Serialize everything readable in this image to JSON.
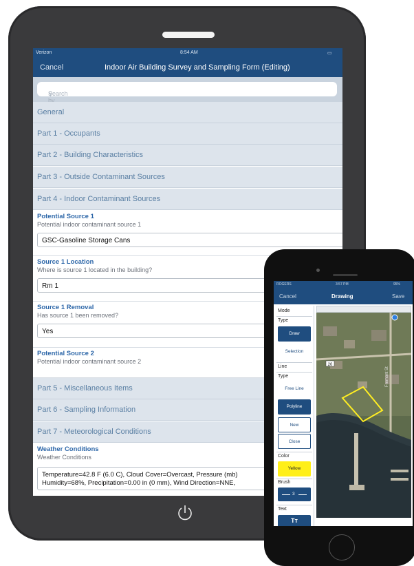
{
  "tablet": {
    "status": {
      "carrier": "Verizon",
      "time": "8:54 AM"
    },
    "nav": {
      "cancel": "Cancel",
      "title": "Indoor Air Building Survey and Sampling Form (Editing)"
    },
    "search": {
      "placeholder": "Search by name"
    },
    "sections": [
      "General",
      "Part 1 - Occupants",
      "Part 2 - Building Characteristics",
      "Part 3 - Outside Contaminant Sources",
      "Part 4 - Indoor Contaminant Sources",
      "Part 5 - Miscellaneous Items",
      "Part 6 - Sampling Information",
      "Part 7 - Meteorological Conditions"
    ],
    "fields": [
      {
        "label": "Potential Source 1",
        "sub": "Potential indoor contaminant source 1",
        "value": "GSC-Gasoline Storage Cans"
      },
      {
        "label": "Source 1 Location",
        "sub": "Where is source 1 located in the building?",
        "value": "Rm 1"
      },
      {
        "label": "Source 1 Removal",
        "sub": "Has source 1 been removed?",
        "value": "Yes"
      },
      {
        "label": "Potential Source 2",
        "sub": "Potential indoor contaminant source 2"
      }
    ],
    "weather": {
      "label": "Weather Conditions",
      "sub": "Weather Conditions",
      "line1": "Temperature=42.8 F (6.0 C), Cloud Cover=Overcast, Pressure (mb)",
      "line2": "Humidity=68%, Precipitation=0.00 in (0 mm), Wind Direction=NNE,"
    }
  },
  "phone": {
    "status": {
      "carrier": "ROGERS",
      "time": "3:57 PM",
      "battery": "95%"
    },
    "nav": {
      "cancel": "Cancel",
      "title": "Drawing",
      "save": "Save"
    },
    "mode_label": "Mode",
    "type_label": "Type",
    "draw": "Draw",
    "selection": "Selection",
    "line_label": "Line",
    "line_type_label": "Type",
    "free_line": "Free Line",
    "polyline": "Polyline",
    "new": "New",
    "close": "Close",
    "color_label": "Color",
    "color_value": "Yellow",
    "brush_label": "Brush",
    "brush_value": "3",
    "text_label": "Text",
    "text_button": "Tᴛ",
    "map_shield": "20",
    "street_label": "Fremont St"
  }
}
